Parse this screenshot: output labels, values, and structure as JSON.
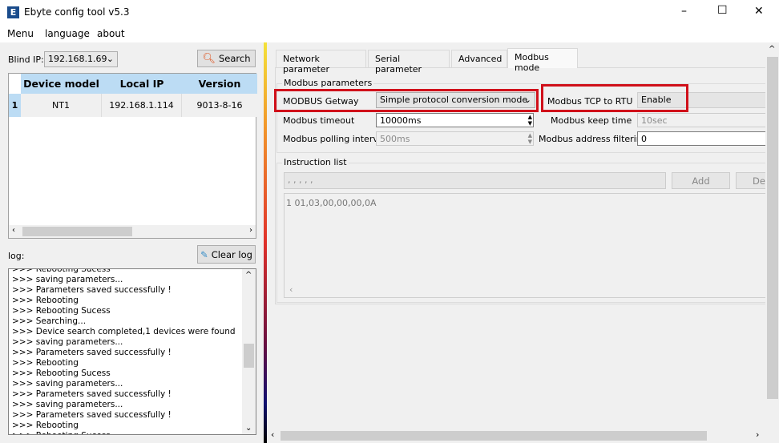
{
  "window": {
    "title": "Ebyte config tool v5.3",
    "logo": "E",
    "controls": [
      "–",
      "☐",
      "✕"
    ]
  },
  "menu": [
    "Menu",
    "language",
    "about"
  ],
  "left": {
    "blind_ip_label": "Blind IP:",
    "blind_ip_value": "192.168.1.69",
    "search_label": "Search",
    "table": {
      "columns": [
        "Device model",
        "Local IP",
        "Version"
      ],
      "rows": [
        {
          "index": "1",
          "cells": [
            "NT1",
            "192.168.1.114",
            "9013-8-16"
          ]
        }
      ]
    },
    "log_label": "log:",
    "clear_log_label": "Clear log",
    "log_lines": [
      ">>> Rebooting Sucess",
      ">>> saving parameters...",
      ">>> Parameters saved successfully !",
      ">>> Rebooting",
      ">>> Rebooting Sucess",
      ">>> Searching...",
      ">>> Device search completed,1 devices were found",
      ">>> saving parameters...",
      ">>> Parameters saved successfully !",
      ">>> Rebooting",
      ">>> Rebooting Sucess",
      ">>> saving parameters...",
      ">>> Parameters saved successfully !",
      ">>> saving parameters...",
      ">>> Parameters saved successfully !",
      ">>> Rebooting",
      ">>> Rebooting Sucess"
    ]
  },
  "tabs": [
    {
      "label": "Network parameter"
    },
    {
      "label": "Serial parameter"
    },
    {
      "label": "Advanced"
    },
    {
      "label": "Modbus mode",
      "active": true
    }
  ],
  "modbus": {
    "group_title": "Modbus parameters",
    "gateway_label": "MODBUS Getway",
    "gateway_value": "Simple protocol conversion mode",
    "tcp_rtu_label": "Modbus TCP to RTU",
    "tcp_rtu_value": "Enable",
    "timeout_label": "Modbus timeout",
    "timeout_value": "10000ms",
    "keep_time_label": "Modbus keep time",
    "keep_time_value": "10sec",
    "polling_label": "Modbus polling interval",
    "polling_value": "500ms",
    "filter_label": "Modbus address filtering",
    "filter_value": "0"
  },
  "instructions": {
    "group_title": "Instruction list",
    "input_value": ", , , , ,",
    "add_label": "Add",
    "del_label": "Del",
    "items": [
      "1  01,03,00,00,00,0A"
    ]
  },
  "colors": {
    "highlight": "#d0101a",
    "header": "#bcdcf4"
  }
}
